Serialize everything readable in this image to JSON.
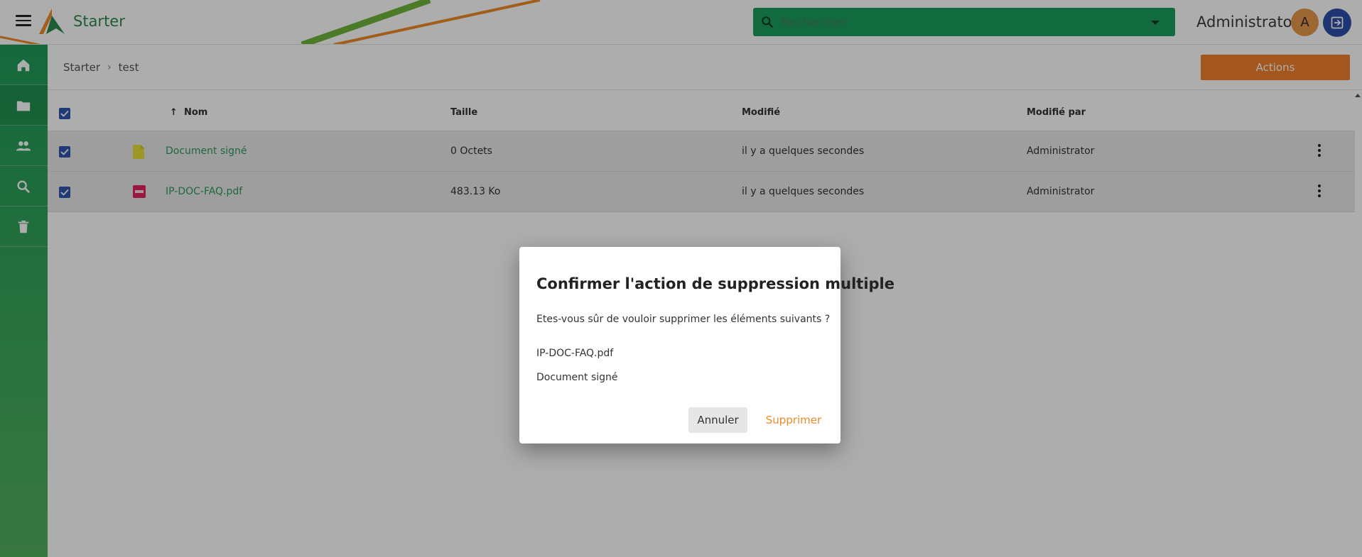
{
  "app": {
    "brand": "Starter"
  },
  "colors": {
    "primary_green": "#1a9e5c",
    "accent_orange": "#f07f2c",
    "avatar_bg": "#e8994a",
    "logout_bg": "#2e4faa",
    "checkbox_blue": "#2e56b0"
  },
  "header": {
    "search": {
      "placeholder": "Rechercher"
    },
    "user": {
      "name": "Administrator",
      "initial": "A"
    }
  },
  "sidebar": {
    "items": [
      {
        "icon": "home-icon"
      },
      {
        "icon": "folder-icon"
      },
      {
        "icon": "people-icon"
      },
      {
        "icon": "search-icon"
      },
      {
        "icon": "trash-icon"
      }
    ]
  },
  "breadcrumb": {
    "items": [
      "Starter",
      "test"
    ],
    "separator": "›"
  },
  "toolbar": {
    "actions_label": "Actions"
  },
  "table": {
    "sort_indicator": "↑",
    "headers": {
      "name": "Nom",
      "size": "Taille",
      "modified": "Modifié",
      "modified_by": "Modifié par"
    },
    "rows": [
      {
        "name": "Document signé",
        "size": "0 Octets",
        "modified": "il y a quelques secondes",
        "modified_by": "Administrator",
        "icon": "document-icon",
        "checked": true
      },
      {
        "name": "IP-DOC-FAQ.pdf",
        "size": "483.13 Ko",
        "modified": "il y a quelques secondes",
        "modified_by": "Administrator",
        "icon": "pdf-icon",
        "checked": true
      }
    ]
  },
  "dialog": {
    "title": "Confirmer l'action de suppression multiple",
    "question": "Etes-vous sûr de vouloir supprimer les éléments suivants ?",
    "items": [
      "IP-DOC-FAQ.pdf",
      "Document signé"
    ],
    "cancel_label": "Annuler",
    "delete_label": "Supprimer"
  }
}
